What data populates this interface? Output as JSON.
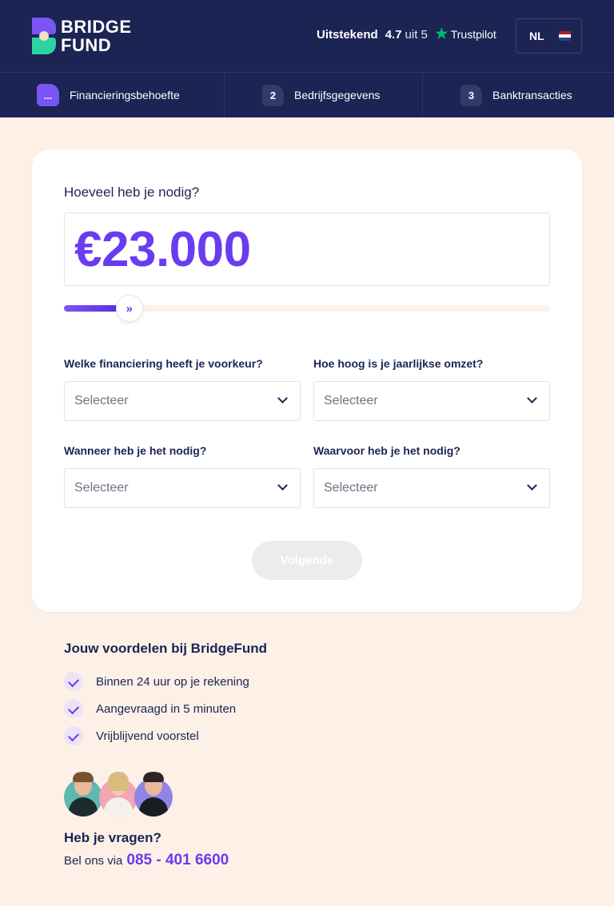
{
  "header": {
    "brand_line1": "BRIDGE",
    "brand_line2": "FUND",
    "rating_word": "Uitstekend",
    "rating_score": "4.7",
    "rating_suffix": "uit 5",
    "trustpilot_label": "Trustpilot",
    "language": "NL"
  },
  "steps": [
    {
      "badge": "...",
      "label": "Financieringsbehoefte"
    },
    {
      "badge": "2",
      "label": "Bedrijfsgegevens"
    },
    {
      "badge": "3",
      "label": "Banktransacties"
    }
  ],
  "form": {
    "amount_question": "Hoeveel heb je nodig?",
    "amount_value": "€23.000",
    "slider_fraction": 0.095,
    "fields": [
      {
        "label": "Welke financiering heeft je voorkeur?",
        "placeholder": "Selecteer"
      },
      {
        "label": "Hoe hoog is je jaarlijkse omzet?",
        "placeholder": "Selecteer"
      },
      {
        "label": "Wanneer heb je het nodig?",
        "placeholder": "Selecteer"
      },
      {
        "label": "Waarvoor heb je het nodig?",
        "placeholder": "Selecteer"
      }
    ],
    "next_label": "Volgende"
  },
  "benefits": {
    "title": "Jouw voordelen bij BridgeFund",
    "items": [
      "Binnen 24 uur op je rekening",
      "Aangevraagd in 5 minuten",
      "Vrijblijvend voorstel"
    ]
  },
  "contact": {
    "title": "Heb je vragen?",
    "call_prefix": "Bel ons via",
    "phone": "085 - 401 6600"
  },
  "colors": {
    "navy": "#1b2453",
    "accent": "#6a3cf0",
    "background": "#fdf1e7",
    "trustpilot_green": "#00b67a"
  }
}
